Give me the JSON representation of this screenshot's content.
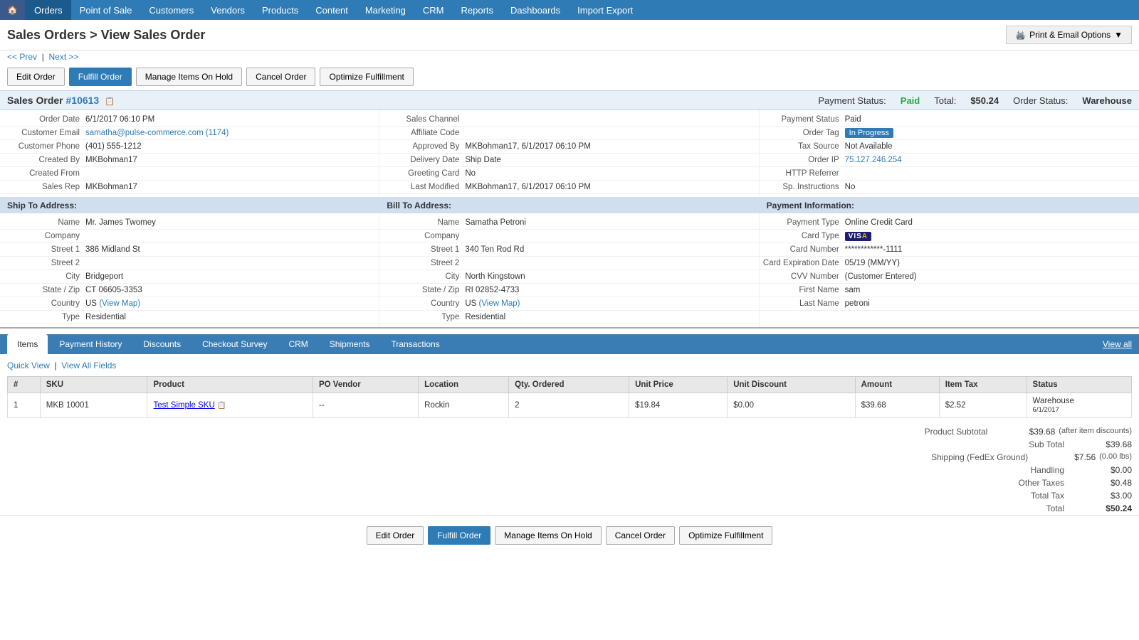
{
  "nav": {
    "home_icon": "🏠",
    "items": [
      "Orders",
      "Point of Sale",
      "Customers",
      "Vendors",
      "Products",
      "Content",
      "Marketing",
      "CRM",
      "Reports",
      "Dashboards",
      "Import Export"
    ],
    "active": "Orders"
  },
  "page": {
    "title": "Sales Orders > View Sales Order",
    "print_label": "Print & Email Options"
  },
  "nav_links": {
    "prev": "<< Prev",
    "next": "Next >>"
  },
  "action_buttons": {
    "edit": "Edit Order",
    "fulfill": "Fulfill Order",
    "manage_hold": "Manage Items On Hold",
    "cancel": "Cancel Order",
    "optimize": "Optimize Fulfillment"
  },
  "order": {
    "number": "#10613",
    "payment_status_label": "Payment Status:",
    "payment_status_value": "Paid",
    "total_label": "Total:",
    "total_value": "$50.24",
    "order_status_label": "Order Status:",
    "order_status_value": "Warehouse"
  },
  "order_details": {
    "order_date_label": "Order Date",
    "order_date_value": "6/1/2017 06:10 PM",
    "customer_email_label": "Customer Email",
    "customer_email_value": "samatha@pulse-commerce.com",
    "customer_email_link": "(1174)",
    "customer_phone_label": "Customer Phone",
    "customer_phone_value": "(401) 555-1212",
    "created_by_label": "Created By",
    "created_by_value": "MKBohman17",
    "created_from_label": "Created From",
    "created_from_value": "",
    "sales_rep_label": "Sales Rep",
    "sales_rep_value": "MKBohman17",
    "sales_channel_label": "Sales Channel",
    "sales_channel_value": "",
    "affiliate_code_label": "Affiliate Code",
    "affiliate_code_value": "",
    "approved_by_label": "Approved By",
    "approved_by_value": "MKBohman17, 6/1/2017 06:10 PM",
    "delivery_date_label": "Delivery Date",
    "delivery_date_value": "Ship Date",
    "greeting_card_label": "Greeting Card",
    "greeting_card_value": "No",
    "last_modified_label": "Last Modified",
    "last_modified_value": "MKBohman17, 6/1/2017 06:10 PM",
    "payment_status_label": "Payment Status",
    "payment_status_value": "Paid",
    "order_tag_label": "Order Tag",
    "order_tag_value": "In Progress",
    "tax_source_label": "Tax Source",
    "tax_source_value": "Not Available",
    "order_ip_label": "Order IP",
    "order_ip_value": "75.127.246.254",
    "http_referrer_label": "HTTP Referrer",
    "http_referrer_value": "",
    "sp_instructions_label": "Sp. Instructions",
    "sp_instructions_value": "No"
  },
  "ship_to": {
    "section_title": "Ship To Address:",
    "name_label": "Name",
    "name_value": "Mr. James Twomey",
    "company_label": "Company",
    "company_value": "",
    "street1_label": "Street 1",
    "street1_value": "386 Midland St",
    "street2_label": "Street 2",
    "street2_value": "",
    "city_label": "City",
    "city_value": "Bridgeport",
    "state_zip_label": "State / Zip",
    "state_zip_value": "CT 06605-3353",
    "country_label": "Country",
    "country_value": "US",
    "view_map_label": "(View Map)",
    "type_label": "Type",
    "type_value": "Residential"
  },
  "bill_to": {
    "section_title": "Bill To Address:",
    "name_label": "Name",
    "name_value": "Samatha Petroni",
    "company_label": "Company",
    "company_value": "",
    "street1_label": "Street 1",
    "street1_value": "340 Ten Rod Rd",
    "street2_label": "Street 2",
    "street2_value": "",
    "city_label": "City",
    "city_value": "North Kingstown",
    "state_zip_label": "State / Zip",
    "state_zip_value": "RI 02852-4733",
    "country_label": "Country",
    "country_value": "US",
    "view_map_label": "(View Map)",
    "type_label": "Type",
    "type_value": "Residential"
  },
  "payment_info": {
    "section_title": "Payment Information:",
    "payment_type_label": "Payment Type",
    "payment_type_value": "Online Credit Card",
    "card_type_label": "Card Type",
    "card_type_value": "VISA",
    "card_number_label": "Card Number",
    "card_number_value": "************-1111",
    "card_expiry_label": "Card Expiration Date",
    "card_expiry_value": "05/19 (MM/YY)",
    "cvv_label": "CVV Number",
    "cvv_value": "(Customer Entered)",
    "first_name_label": "First Name",
    "first_name_value": "sam",
    "last_name_label": "Last Name",
    "last_name_value": "petroni"
  },
  "tabs": {
    "items": [
      {
        "label": "Items",
        "active": true
      },
      {
        "label": "Payment History",
        "active": false
      },
      {
        "label": "Discounts",
        "active": false
      },
      {
        "label": "Checkout Survey",
        "active": false
      },
      {
        "label": "CRM",
        "active": false
      },
      {
        "label": "Shipments",
        "active": false
      },
      {
        "label": "Transactions",
        "active": false
      }
    ],
    "view_all": "View all"
  },
  "items_table": {
    "quick_view": "Quick View",
    "view_all_fields": "View All Fields",
    "columns": [
      "#",
      "SKU",
      "Product",
      "PO Vendor",
      "Location",
      "Qty. Ordered",
      "Unit Price",
      "Unit Discount",
      "Amount",
      "Item Tax",
      "Status"
    ],
    "rows": [
      {
        "num": "1",
        "sku": "MKB 10001",
        "product": "Test Simple SKU",
        "po_vendor": "--",
        "location": "Rockin",
        "qty": "2",
        "unit_price": "$19.84",
        "unit_discount": "$0.00",
        "amount": "$39.68",
        "item_tax": "$2.52",
        "status": "Warehouse 6/1/2017"
      }
    ]
  },
  "totals": {
    "product_subtotal_label": "Product Subtotal",
    "product_subtotal_value": "$39.68",
    "product_subtotal_note": "(after item discounts)",
    "subtotal_label": "Sub Total",
    "subtotal_value": "$39.68",
    "shipping_label": "Shipping (FedEx Ground)",
    "shipping_value": "$7.56",
    "shipping_note": "(0.00 lbs)",
    "handling_label": "Handling",
    "handling_value": "$0.00",
    "other_taxes_label": "Other Taxes",
    "other_taxes_value": "$0.48",
    "total_tax_label": "Total Tax",
    "total_tax_value": "$3.00",
    "total_label": "Total",
    "total_value": "$50.24"
  }
}
